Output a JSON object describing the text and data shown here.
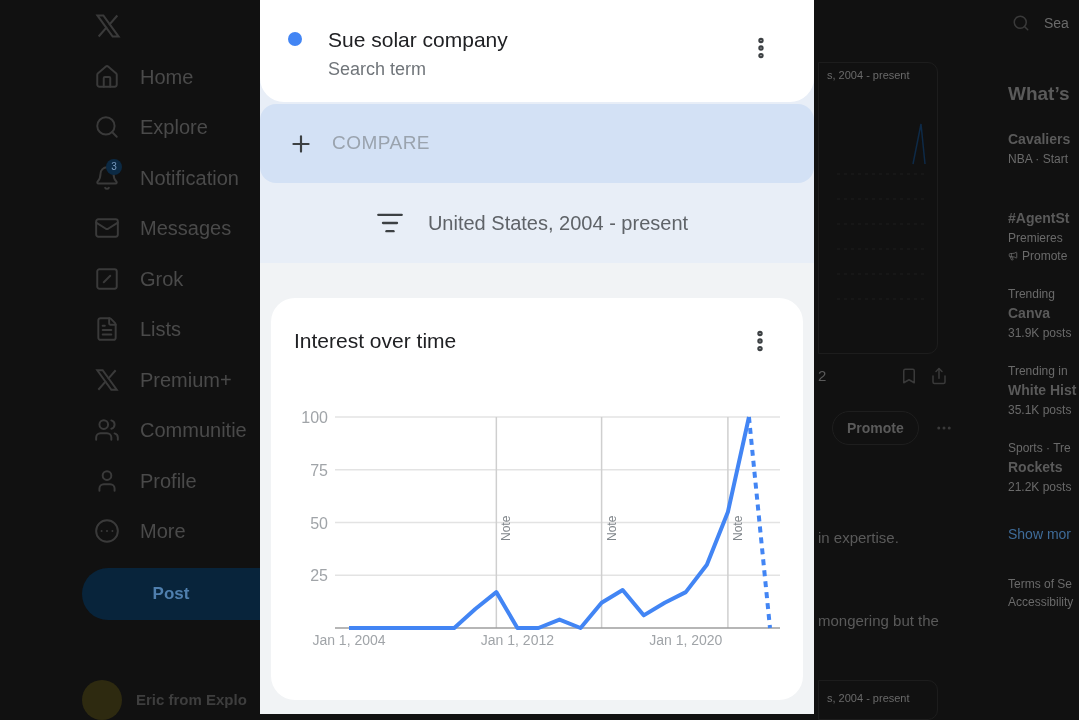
{
  "sidebar": {
    "items": [
      {
        "label": "Home"
      },
      {
        "label": "Explore"
      },
      {
        "label": "Notification",
        "badge": "3"
      },
      {
        "label": "Messages"
      },
      {
        "label": "Grok"
      },
      {
        "label": "Lists"
      },
      {
        "label": "Premium+"
      },
      {
        "label": "Communitie"
      },
      {
        "label": "Profile"
      },
      {
        "label": "More"
      }
    ],
    "post_button": "Post",
    "account": "Eric from Explo"
  },
  "modal": {
    "search_term": {
      "name": "Sue solar company",
      "subtitle": "Search term"
    },
    "compare": "COMPARE",
    "filter": "United States, 2004 - present",
    "interest_card": {
      "title": "Interest over time",
      "chart_data": {
        "type": "line",
        "categories": [
          "Jan 1, 2004",
          null,
          null,
          null,
          null,
          null,
          null,
          null,
          "Jan 1, 2012",
          null,
          null,
          null,
          null,
          null,
          null,
          null,
          "Jan 1, 2020",
          null,
          null,
          null,
          null
        ],
        "series": [
          {
            "color": "#4285f4",
            "values": [
              0,
              0,
              0,
              0,
              0,
              0,
              9,
              17,
              0,
              0,
              4,
              0,
              12,
              18,
              6,
              12,
              17,
              30,
              55,
              100,
              0
            ]
          }
        ],
        "ylim": [
          0,
          100
        ],
        "yticks": [
          25,
          50,
          75,
          100
        ],
        "grid": true,
        "annotations": [
          "Note",
          "Note",
          "Note"
        ]
      }
    }
  },
  "background_post": {
    "caption_top": "s, 2004 - present",
    "count": "2",
    "promote": "Promote",
    "text_lines": [
      "in expertise.",
      "mongering but the"
    ],
    "caption_bottom": "s, 2004 - present"
  },
  "right_column": {
    "search_placeholder": "Sea",
    "heading": "What’s",
    "trends": [
      {
        "title": "Cavaliers",
        "meta": "NBA · Start"
      },
      {
        "title": "#AgentSt",
        "meta": "Premieres",
        "promoted": "Promote"
      },
      {
        "context": "Trending",
        "title": "Canva",
        "meta": "31.9K posts"
      },
      {
        "context": "Trending in",
        "title": "White Hist",
        "meta": "35.1K posts"
      },
      {
        "context": "Sports · Tre",
        "title": "Rockets",
        "meta": "21.2K posts"
      }
    ],
    "show_more": "Show mor",
    "footer": [
      "Terms of Se",
      "Accessibility"
    ]
  }
}
